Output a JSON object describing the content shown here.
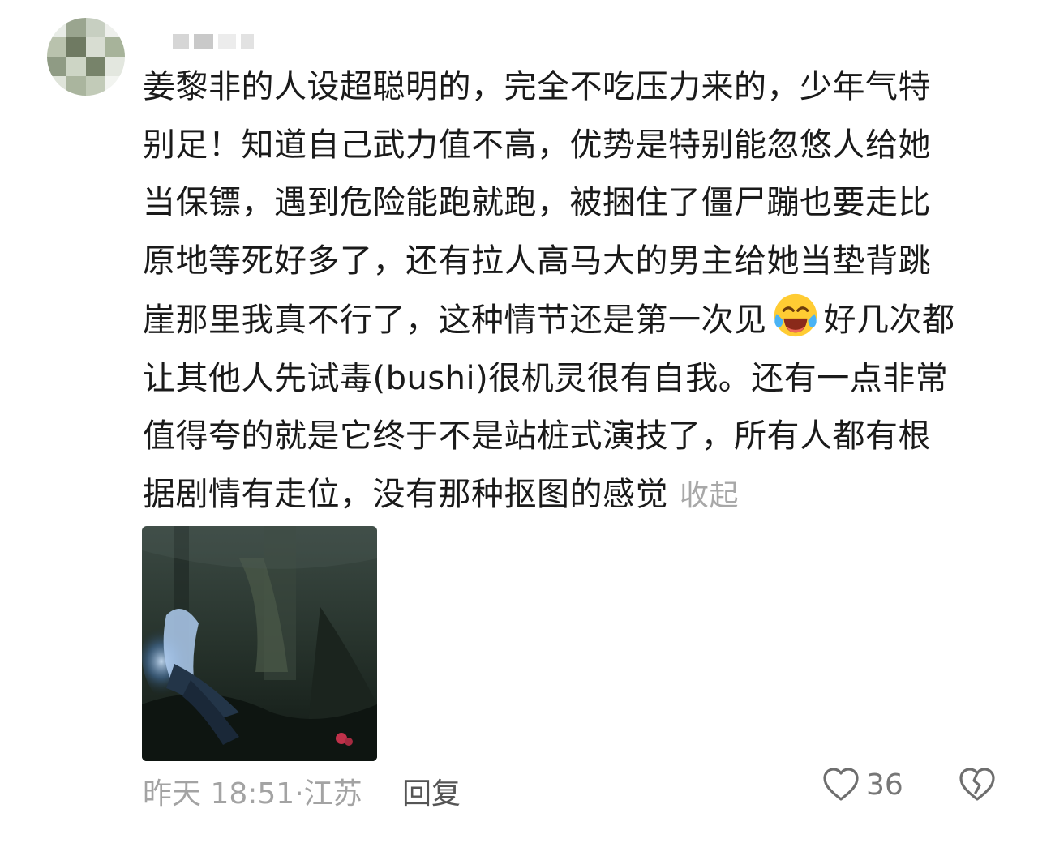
{
  "comment": {
    "line1": "姜黎非的人设超聪明的，完全不吃压力来的，少年气特",
    "line2": "别足！知道自己武力值不高，优势是特别能忽悠人给她",
    "line3": "当保镖，遇到危险能跑就跑，被捆住了僵尸蹦也要走比",
    "line4": "原地等死好多了，还有拉人高马大的男主给她当垫背跳",
    "line5_a": "崖那里我真不行了，这种情节还是第一次见",
    "line5_b": "好几次都",
    "line6": "让其他人先试毒(bushi)很机灵很有自我。还有一点非常",
    "line7": "值得夸的就是它终于不是站桩式演技了，所有人都有根",
    "line8": "据剧情有走位，没有那种抠图的感觉",
    "collapse_label": "收起",
    "emoji_icon": "laughing-crying-emoji"
  },
  "footer": {
    "time": "昨天 18:51",
    "separator": "·",
    "location": "江苏",
    "reply_label": "回复",
    "like_count": "36",
    "like_icon": "heart-outline-icon",
    "dislike_icon": "broken-heart-icon"
  },
  "colors": {
    "text": "#1a1a1a",
    "secondary": "#a3a3a3",
    "reply": "#555555"
  }
}
